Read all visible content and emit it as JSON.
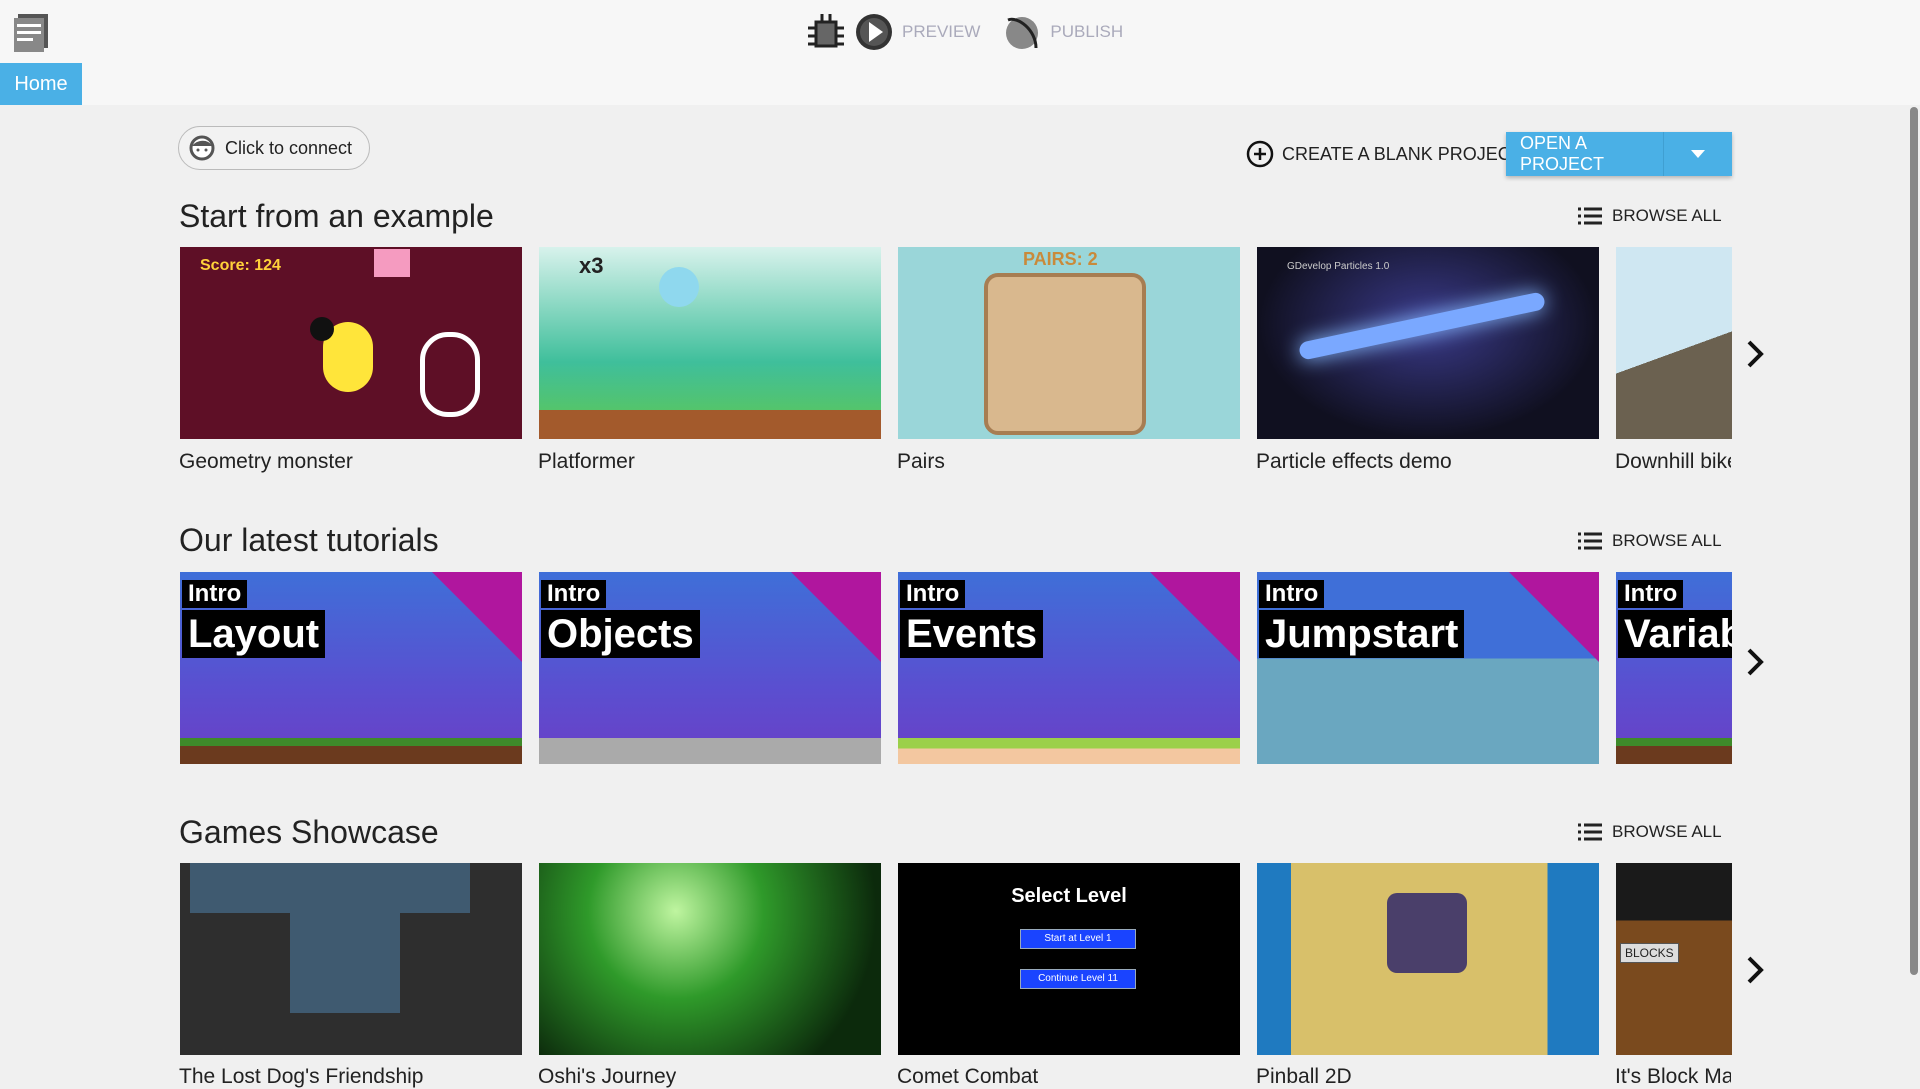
{
  "header": {
    "home_tab": "Home",
    "toolbar": {
      "preview": "PREVIEW",
      "publish": "PUBLISH"
    },
    "icons": [
      "menu-icon",
      "debug-bug-icon",
      "play-icon",
      "publish-globe-icon"
    ]
  },
  "actions": {
    "connect": "Click to connect",
    "create_blank": "CREATE A BLANK PROJECT",
    "open_project": "OPEN A PROJECT"
  },
  "colors": {
    "accent": "#4ab0e6",
    "background": "#f0f0f0"
  },
  "sections": [
    {
      "title": "Start from an example",
      "browse": "BROWSE ALL",
      "items": [
        {
          "label": "Geometry monster",
          "thumb_text": "Score: 124"
        },
        {
          "label": "Platformer",
          "thumb_text": "x3"
        },
        {
          "label": "Pairs",
          "thumb_text": "PAIRS: 2"
        },
        {
          "label": "Particle effects demo",
          "thumb_text": "GDevelop Particles 1.0"
        },
        {
          "label": "Downhill bike",
          "thumb_text": ""
        }
      ]
    },
    {
      "title": "Our latest tutorials",
      "browse": "BROWSE ALL",
      "items": [
        {
          "intro": "Intro",
          "title": "Layout"
        },
        {
          "intro": "Intro",
          "title": "Objects"
        },
        {
          "intro": "Intro",
          "title": "Events"
        },
        {
          "intro": "Intro",
          "title": "Jumpstart"
        },
        {
          "intro": "Intro",
          "title": "Variables"
        }
      ]
    },
    {
      "title": "Games Showcase",
      "browse": "BROWSE ALL",
      "items": [
        {
          "label": "The Lost Dog's Friendship"
        },
        {
          "label": "Oshi's Journey"
        },
        {
          "label": "Comet Combat",
          "thumb_title": "Select Level",
          "thumb_btn1": "Start at Level 1",
          "thumb_btn2": "Continue Level 11"
        },
        {
          "label": "Pinball 2D"
        },
        {
          "label": "It's Block Ma",
          "thumb_text": "BLOCKS"
        }
      ]
    }
  ]
}
